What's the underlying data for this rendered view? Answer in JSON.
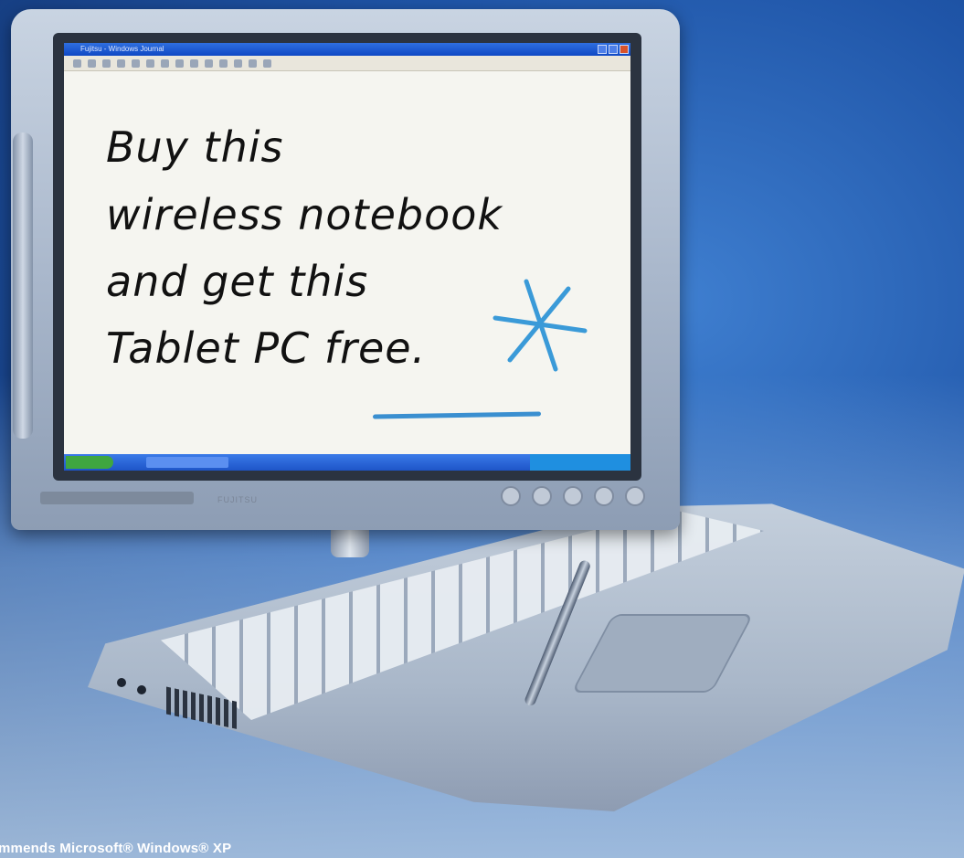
{
  "screen": {
    "window_title": "Fujitsu - Windows Journal",
    "handwriting": {
      "line1": "Buy this",
      "line2": "wireless notebook",
      "line3": "and get this",
      "line4": "Tablet PC free."
    },
    "start_label": "start"
  },
  "device": {
    "brand": "FUJITSU"
  },
  "footer": {
    "text": "mmends Microsoft® Windows® XP"
  },
  "colors": {
    "background": "#1f55a8",
    "ink": "#111111",
    "accent_ink": "#3a8fd0"
  }
}
